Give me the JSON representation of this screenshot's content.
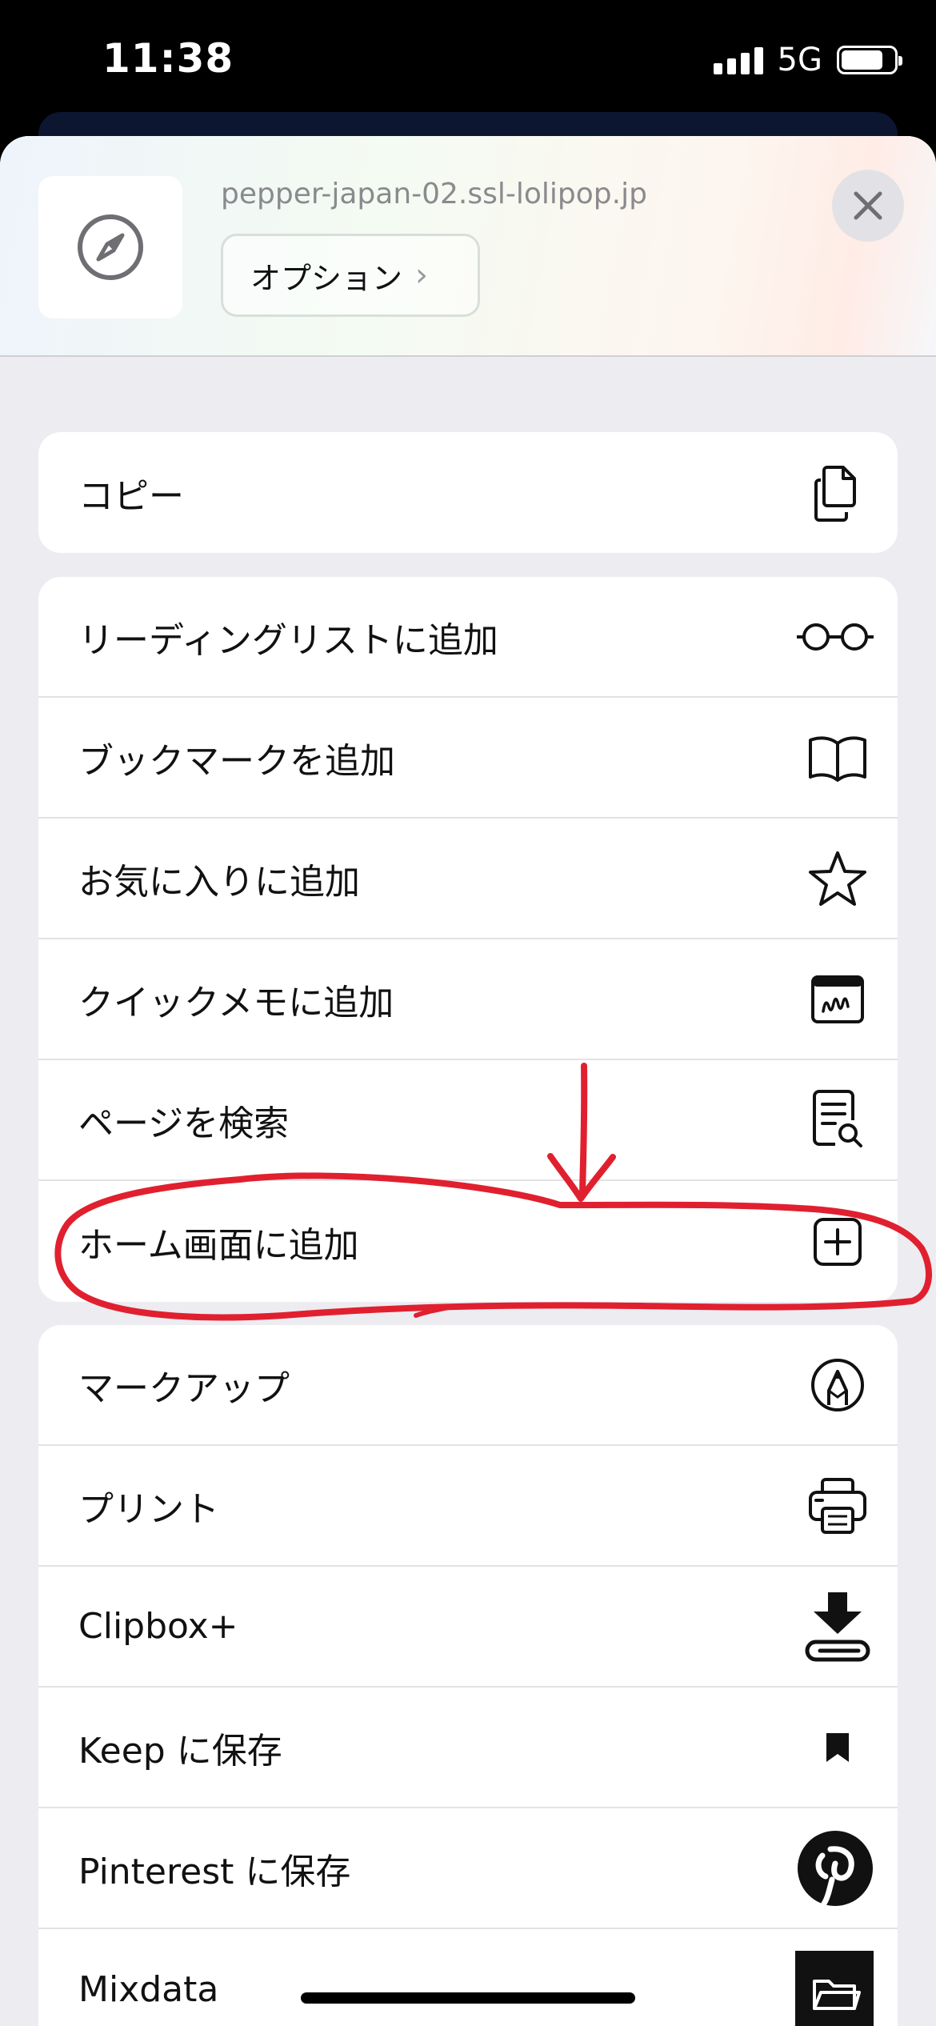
{
  "status_bar": {
    "time": "11:38",
    "network": "5G",
    "signal_bars": 4,
    "battery_level": 0.8
  },
  "header": {
    "site_url": "pepper-japan-02.ssl-lolipop.jp",
    "site_icon": "compass-icon",
    "options_label": "オプション",
    "options_chevron": "›",
    "close_icon": "close-icon"
  },
  "groups": [
    {
      "items": [
        {
          "label": "コピー",
          "icon": "copy-icon"
        }
      ]
    },
    {
      "items": [
        {
          "label": "リーディングリストに追加",
          "icon": "glasses-icon"
        },
        {
          "label": "ブックマークを追加",
          "icon": "book-icon"
        },
        {
          "label": "お気に入りに追加",
          "icon": "star-icon"
        },
        {
          "label": "クイックメモに追加",
          "icon": "quick-note-icon"
        },
        {
          "label": "ページを検索",
          "icon": "find-page-icon"
        },
        {
          "label": "ホーム画面に追加",
          "icon": "plus-square-icon"
        }
      ]
    },
    {
      "items": [
        {
          "label": "マークアップ",
          "icon": "markup-pen-icon"
        },
        {
          "label": "プリント",
          "icon": "printer-icon"
        },
        {
          "label": "Clipbox+",
          "icon": "download-clip-icon"
        },
        {
          "label": "Keep に保存",
          "icon": "bookmark-icon"
        },
        {
          "label": "Pinterest に保存",
          "icon": "pinterest-icon"
        },
        {
          "label": "Mixdata",
          "icon": "folder-icon"
        }
      ]
    }
  ],
  "colors": {
    "annotation": "#e0202f",
    "sheet_bg": "#ececf1"
  }
}
